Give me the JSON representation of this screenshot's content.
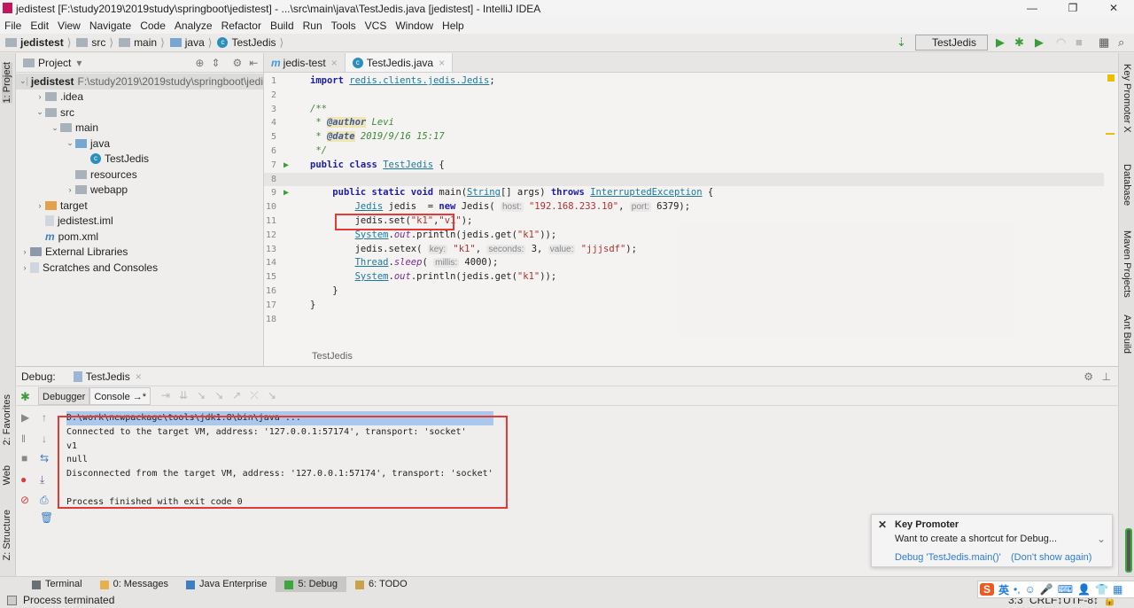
{
  "window": {
    "title": "jedistest [F:\\study2019\\2019study\\springboot\\jedistest] - ...\\src\\main\\java\\TestJedis.java [jedistest] - IntelliJ IDEA",
    "minimize": "—",
    "maximize": "❐",
    "close": "✕"
  },
  "menu": [
    "File",
    "Edit",
    "View",
    "Navigate",
    "Code",
    "Analyze",
    "Refactor",
    "Build",
    "Run",
    "Tools",
    "VCS",
    "Window",
    "Help"
  ],
  "breadcrumb": [
    "jedistest",
    "src",
    "main",
    "java",
    "TestJedis"
  ],
  "toolbar": {
    "run_config": "TestJedis",
    "accent": "#3a9d3a"
  },
  "left_strip": {
    "project": "1: Project",
    "favorites": "2: Favorites",
    "web": "Web",
    "structure": "Z: Structure"
  },
  "right_strip": [
    "Key Promoter X",
    "Database",
    "Maven Projects",
    "Ant Build"
  ],
  "project": {
    "title": "Project",
    "tree": [
      {
        "label": "jedistest",
        "extra": "F:\\study2019\\2019study\\springboot\\jedi",
        "depth": 0,
        "arrow": "⌄",
        "icon": "module",
        "bold": true
      },
      {
        "label": ".idea",
        "depth": 1,
        "arrow": "›",
        "icon": "folder"
      },
      {
        "label": "src",
        "depth": 1,
        "arrow": "⌄",
        "icon": "folder"
      },
      {
        "label": "main",
        "depth": 2,
        "arrow": "⌄",
        "icon": "folder"
      },
      {
        "label": "java",
        "depth": 3,
        "arrow": "⌄",
        "icon": "folder-blue"
      },
      {
        "label": "TestJedis",
        "depth": 4,
        "arrow": "",
        "icon": "class"
      },
      {
        "label": "resources",
        "depth": 3,
        "arrow": "",
        "icon": "folder"
      },
      {
        "label": "webapp",
        "depth": 3,
        "arrow": "›",
        "icon": "folder"
      },
      {
        "label": "target",
        "depth": 1,
        "arrow": "›",
        "icon": "folder-orange"
      },
      {
        "label": "jedistest.iml",
        "depth": 1,
        "arrow": "",
        "icon": "file"
      },
      {
        "label": "pom.xml",
        "depth": 1,
        "arrow": "",
        "icon": "maven"
      },
      {
        "label": "External Libraries",
        "depth": 0,
        "arrow": "›",
        "icon": "library"
      },
      {
        "label": "Scratches and Consoles",
        "depth": 0,
        "arrow": "›",
        "icon": "scratch"
      }
    ]
  },
  "editor": {
    "tabs": [
      {
        "label": "jedis-test",
        "icon": "m"
      },
      {
        "label": "TestJedis.java",
        "icon": "c",
        "active": true
      }
    ],
    "lines": [
      [
        [
          "kw",
          "import "
        ],
        [
          "cl",
          "redis.clients.jedis.Jedis"
        ],
        [
          "p",
          ";"
        ]
      ],
      [],
      [
        [
          "cm",
          "/**"
        ]
      ],
      [
        [
          "cm",
          " * "
        ],
        [
          "cmt",
          "@author"
        ],
        [
          "cm",
          " Levi"
        ]
      ],
      [
        [
          "cm",
          " * "
        ],
        [
          "cmt",
          "@date"
        ],
        [
          "cm",
          " 2019/9/16 15:17"
        ]
      ],
      [
        [
          "cm",
          " */"
        ]
      ],
      [
        [
          "kw",
          "public class "
        ],
        [
          "cl",
          "TestJedis"
        ],
        [
          "p",
          " {"
        ]
      ],
      [],
      [
        [
          "p",
          "    "
        ],
        [
          "kw",
          "public static void "
        ],
        [
          "p",
          "main("
        ],
        [
          "cl",
          "String"
        ],
        [
          "p",
          "[] args) "
        ],
        [
          "kw",
          "throws "
        ],
        [
          "cl",
          "InterruptedException"
        ],
        [
          "p",
          " {"
        ]
      ],
      [
        [
          "p",
          "        "
        ],
        [
          "cl",
          "Jedis"
        ],
        [
          "p",
          " jedis  = "
        ],
        [
          "kw",
          "new "
        ],
        [
          "p",
          "Jedis( "
        ],
        [
          "h",
          "host:"
        ],
        [
          "str",
          " \"192.168.233.10\""
        ],
        [
          "p",
          ", "
        ],
        [
          "h",
          "port:"
        ],
        [
          "p",
          " 6379);"
        ]
      ],
      [
        [
          "p",
          "        jedis.set("
        ],
        [
          "str",
          "\"k1\""
        ],
        [
          "p",
          ","
        ],
        [
          "str",
          "\"v1\""
        ],
        [
          "p",
          ");"
        ]
      ],
      [
        [
          "p",
          "        "
        ],
        [
          "cl",
          "System"
        ],
        [
          "p",
          "."
        ],
        [
          "f",
          "out"
        ],
        [
          "p",
          ".println(jedis.get("
        ],
        [
          "str",
          "\"k1\""
        ],
        [
          "p",
          "));"
        ]
      ],
      [
        [
          "p",
          "        jedis.setex( "
        ],
        [
          "h",
          "key:"
        ],
        [
          "str",
          " \"k1\""
        ],
        [
          "p",
          ", "
        ],
        [
          "h",
          "seconds:"
        ],
        [
          "p",
          " 3, "
        ],
        [
          "h",
          "value:"
        ],
        [
          "str",
          " \"jjjsdf\""
        ],
        [
          "p",
          ");"
        ]
      ],
      [
        [
          "p",
          "        "
        ],
        [
          "cl",
          "Thread"
        ],
        [
          "p",
          "."
        ],
        [
          "f",
          "sleep"
        ],
        [
          "p",
          "( "
        ],
        [
          "h",
          "millis:"
        ],
        [
          "p",
          " 4000);"
        ]
      ],
      [
        [
          "p",
          "        "
        ],
        [
          "cl",
          "System"
        ],
        [
          "p",
          "."
        ],
        [
          "f",
          "out"
        ],
        [
          "p",
          ".println(jedis.get("
        ],
        [
          "str",
          "\"k1\""
        ],
        [
          "p",
          "));"
        ]
      ],
      [
        [
          "p",
          "    }"
        ]
      ],
      [
        [
          "p",
          "}"
        ]
      ],
      []
    ],
    "run_gutter_lines": [
      7,
      9
    ],
    "footer_breadcrumb": "TestJedis"
  },
  "debug": {
    "label": "Debug:",
    "session": "TestJedis",
    "tabs": [
      "Debugger",
      "Console →*"
    ],
    "console": [
      "D:\\work\\newpackage\\tools\\jdk1.8\\bin\\java ...",
      "Connected to the target VM, address: '127.0.0.1:57174', transport: 'socket'",
      "v1",
      "null",
      "Disconnected from the target VM, address: '127.0.0.1:57174', transport: 'socket'",
      "",
      "Process finished with exit code 0"
    ]
  },
  "bottom_tabs": [
    {
      "label": "Terminal",
      "color": "#6b7075"
    },
    {
      "label": "0: Messages",
      "color": "#e8b04a"
    },
    {
      "label": "Java Enterprise",
      "color": "#3d7fc0"
    },
    {
      "label": "5: Debug",
      "color": "#3aa83a",
      "active": true
    },
    {
      "label": "6: TODO",
      "color": "#c9a24a"
    }
  ],
  "status": {
    "text": "Process terminated",
    "position": "3:3",
    "line_sep": "CRLF↕",
    "encoding": "UTF-8↕"
  },
  "notification": {
    "title": "Key Promoter",
    "message": "Want to create a shortcut for Debug...",
    "action1": "Debug 'TestJedis.main()'",
    "action2": "(Don't show again)"
  },
  "ime": {
    "lang": "英"
  }
}
